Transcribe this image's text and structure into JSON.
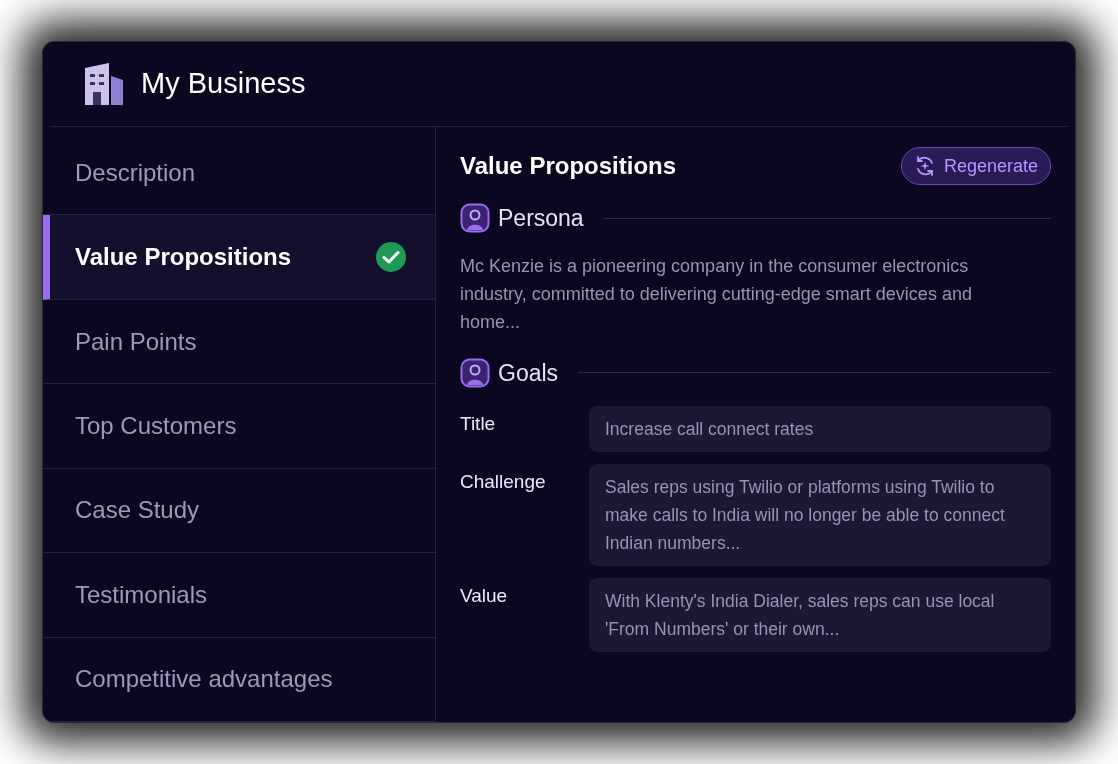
{
  "header": {
    "title": "My Business"
  },
  "sidebar": {
    "items": [
      {
        "label": "Description",
        "selected": false,
        "done": false
      },
      {
        "label": "Value Propositions",
        "selected": true,
        "done": true
      },
      {
        "label": "Pain Points",
        "selected": false,
        "done": false
      },
      {
        "label": "Top Customers",
        "selected": false,
        "done": false
      },
      {
        "label": "Case Study",
        "selected": false,
        "done": false
      },
      {
        "label": "Testimonials",
        "selected": false,
        "done": false
      },
      {
        "label": "Competitive advantages",
        "selected": false,
        "done": false
      }
    ]
  },
  "content": {
    "title": "Value Propositions",
    "regenerate_button": "Regenerate",
    "persona": {
      "heading": "Persona",
      "text": "Mc Kenzie is a pioneering company in the consumer electronics industry, committed to delivering cutting-edge smart devices and home..."
    },
    "goals": {
      "heading": "Goals",
      "fields": [
        {
          "label": "Title",
          "value": "Increase call connect rates"
        },
        {
          "label": "Challenge",
          "value": "Sales reps using Twilio or platforms using Twilio to make calls to India will no longer be able to connect Indian numbers..."
        },
        {
          "label": "Value",
          "value": "With Klenty's India Dialer, sales reps can use local 'From Numbers' or their own..."
        }
      ]
    }
  }
}
